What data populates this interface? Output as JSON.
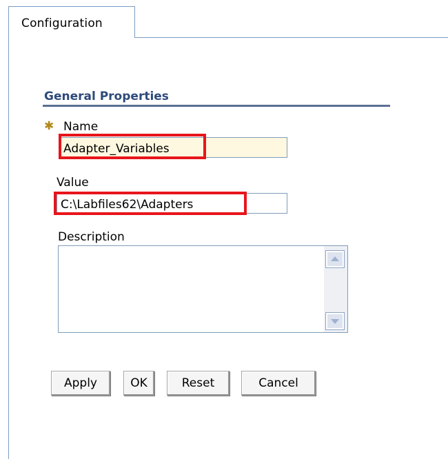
{
  "tabs": [
    {
      "label": "Configuration",
      "active": true
    }
  ],
  "section": {
    "title": "General Properties"
  },
  "form": {
    "name": {
      "required_mark": "✱",
      "label": "Name",
      "value": "Adapter_Variables"
    },
    "value": {
      "label": "Value",
      "value": "C:\\Labfiles62\\Adapters"
    },
    "description": {
      "label": "Description",
      "value": ""
    }
  },
  "buttons": {
    "apply": "Apply",
    "ok": "OK",
    "reset": "Reset",
    "cancel": "Cancel"
  },
  "colors": {
    "highlight": "#e8151b",
    "section_title": "#2e4a7a",
    "required_field_bg": "#fff8e0",
    "required_mark": "#b08a1a"
  }
}
